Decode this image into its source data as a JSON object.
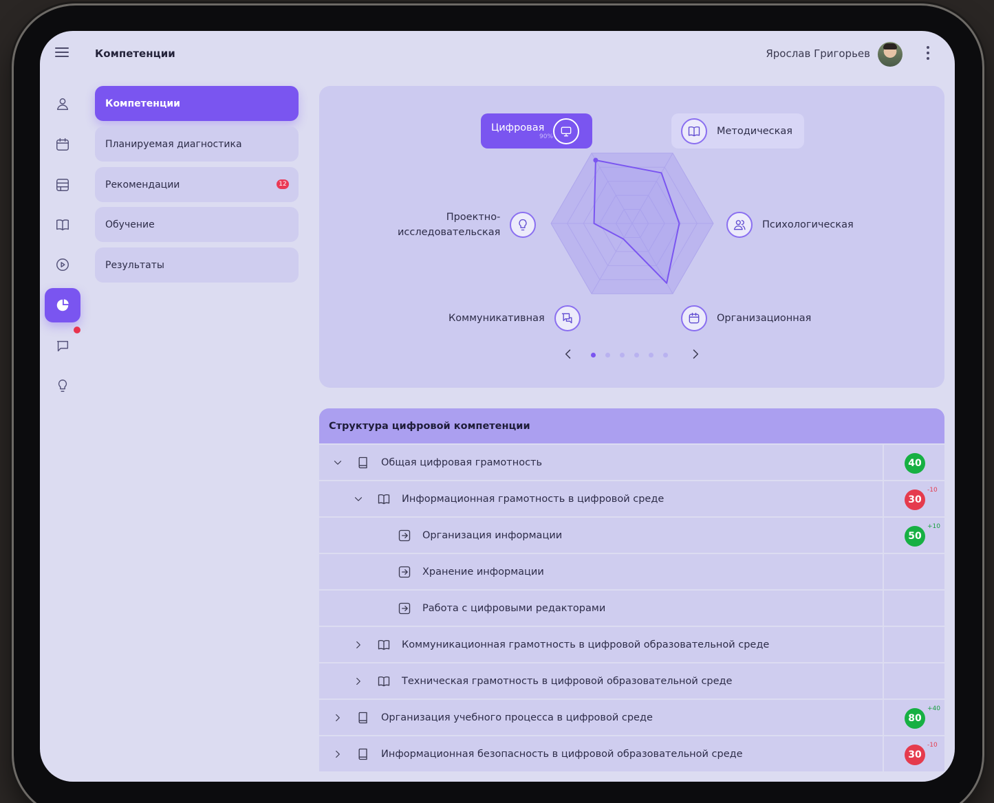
{
  "header": {
    "title": "Компетенции",
    "user_name": "Ярослав Григорьев"
  },
  "rail": {
    "items": [
      "user-icon",
      "calendar-icon",
      "catalog-icon",
      "book-icon",
      "play-icon",
      "pie-chart-icon",
      "chat-icon",
      "lightbulb-icon"
    ],
    "active": "pie-chart-icon",
    "notification_color": "#e8334d"
  },
  "menu": {
    "items": [
      {
        "label": "Компетенции"
      },
      {
        "label": "Планируемая диагностика"
      },
      {
        "label": "Рекомендации",
        "badge": "12"
      },
      {
        "label": "Обучение"
      },
      {
        "label": "Результаты"
      }
    ],
    "active": "Компетенции"
  },
  "radar": {
    "selected": {
      "name": "Цифровая",
      "percent": "90%"
    },
    "competencies": [
      "Цифровая",
      "Методическая",
      "Психологическая",
      "Организационная",
      "Коммуникативная",
      "Проектно-исследовательская"
    ],
    "label_lines": {
      "project": [
        "Проектно-",
        "исследовательская"
      ]
    },
    "values": [
      90,
      72,
      58,
      85,
      22,
      47
    ],
    "max": 100,
    "carousel": {
      "pages": 6,
      "current": 1
    }
  },
  "structure": {
    "title": "Структура цифровой компетенции",
    "rows": [
      {
        "text": "Общая цифровая грамотность",
        "chevron": "down",
        "icon": "book-closed-icon",
        "level": 0,
        "score": "40",
        "score_color": "green"
      },
      {
        "text": "Информационная грамотность в цифровой среде",
        "chevron": "down",
        "icon": "book-open-icon",
        "level": 1,
        "score": "30",
        "score_color": "red",
        "delta": "-10"
      },
      {
        "text": "Организация информации",
        "icon": "arrow-box-icon",
        "level": 2,
        "score": "50",
        "score_color": "green",
        "delta": "+10"
      },
      {
        "text": "Хранение информации",
        "icon": "arrow-box-icon",
        "level": 2
      },
      {
        "text": "Работа с цифровыми редакторами",
        "icon": "arrow-box-icon",
        "level": 2
      },
      {
        "text": "Коммуникационная грамотность в цифровой образовательной среде",
        "chevron": "right",
        "icon": "book-open-icon",
        "level": 1
      },
      {
        "text": "Техническая грамотность в цифровой  образовательной среде",
        "chevron": "right",
        "icon": "book-open-icon",
        "level": 1
      },
      {
        "text": "Организация учебного процесса в цифровой среде",
        "chevron": "right",
        "icon": "book-closed-icon",
        "level": 0,
        "score": "80",
        "score_color": "green",
        "delta": "+40"
      },
      {
        "text": "Информационная безопасность в цифровой образовательной среде",
        "chevron": "right",
        "icon": "book-closed-icon",
        "level": 0,
        "score": "30",
        "score_color": "red",
        "delta": "-10"
      }
    ]
  },
  "colors": {
    "accent": "#7a55f0",
    "green": "#17b043",
    "red": "#e53b4d"
  }
}
